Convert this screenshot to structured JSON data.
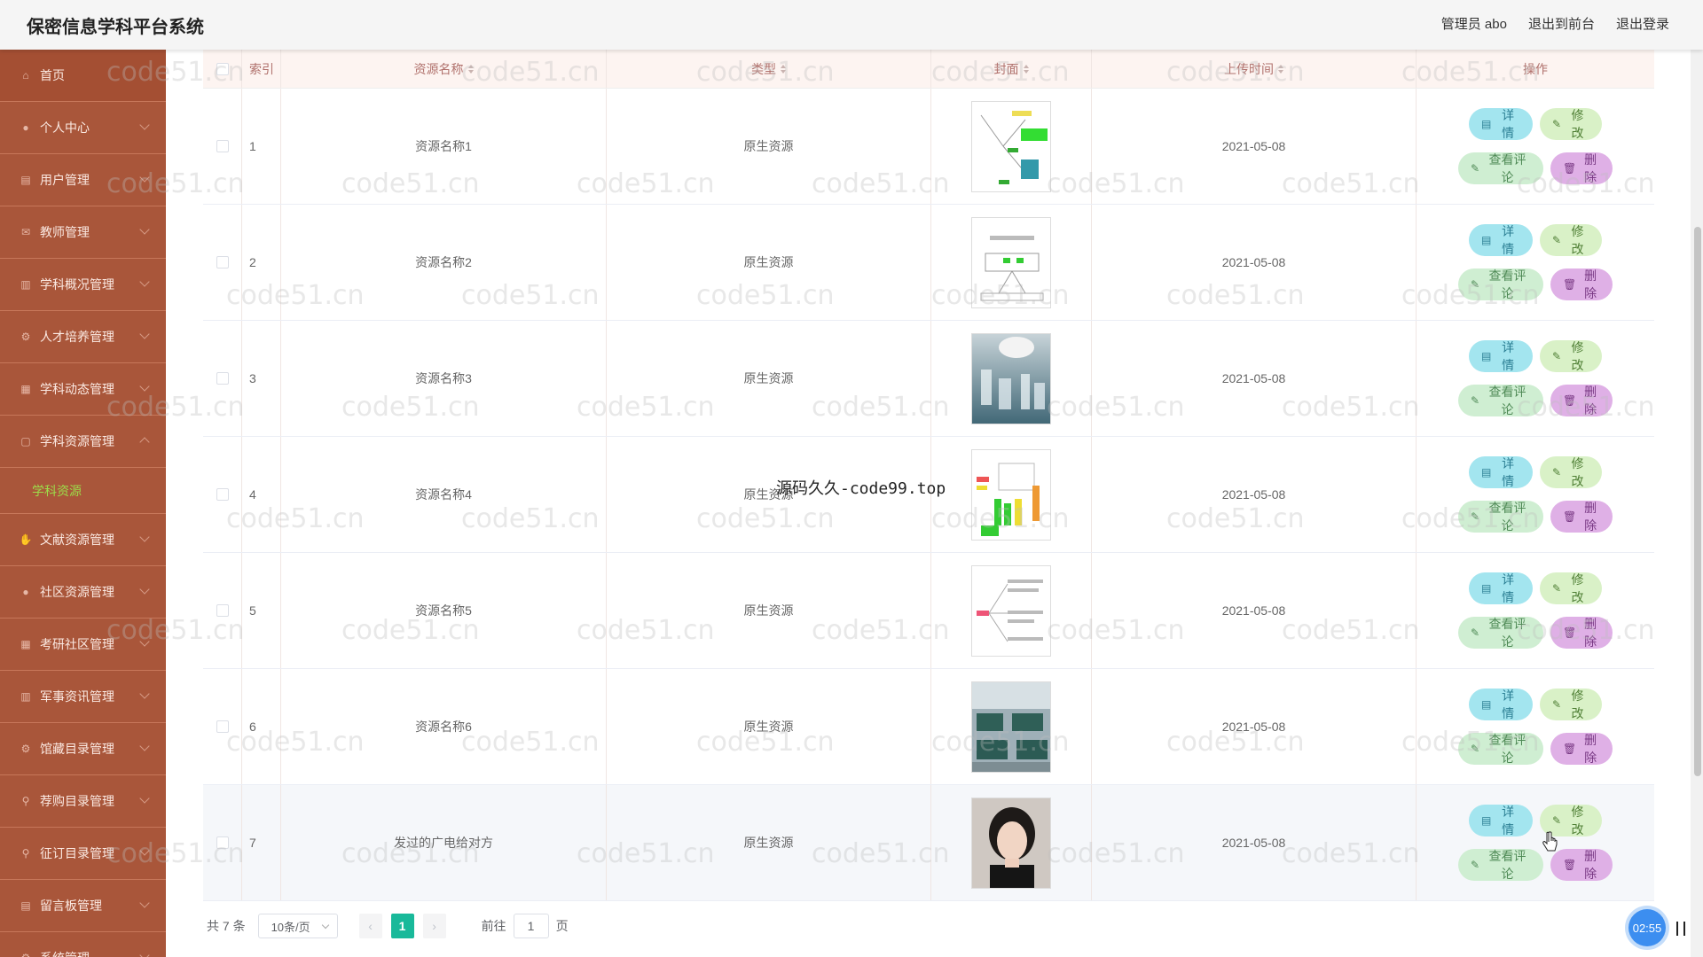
{
  "header": {
    "app_title": "保密信息学科平台系统",
    "admin_label": "管理员 abo",
    "back_front": "退出到前台",
    "logout": "退出登录"
  },
  "sidebar": {
    "items": [
      {
        "label": "首页",
        "icon": "home-icon"
      },
      {
        "label": "个人中心",
        "icon": "user-icon"
      },
      {
        "label": "用户管理",
        "icon": "document-icon"
      },
      {
        "label": "教师管理",
        "icon": "mail-icon"
      },
      {
        "label": "学科概况管理",
        "icon": "chart-icon"
      },
      {
        "label": "人才培养管理",
        "icon": "gear-icon"
      },
      {
        "label": "学科动态管理",
        "icon": "grid-icon"
      },
      {
        "label": "学科资源管理",
        "icon": "folder-icon",
        "open": true
      },
      {
        "label": "文献资源管理",
        "icon": "thumbs-icon"
      },
      {
        "label": "社区资源管理",
        "icon": "user-icon"
      },
      {
        "label": "考研社区管理",
        "icon": "grid-icon"
      },
      {
        "label": "军事资讯管理",
        "icon": "chart-icon"
      },
      {
        "label": "馆藏目录管理",
        "icon": "gear-icon"
      },
      {
        "label": "荐购目录管理",
        "icon": "pin-icon"
      },
      {
        "label": "征订目录管理",
        "icon": "pin-icon"
      },
      {
        "label": "留言板管理",
        "icon": "document-icon"
      },
      {
        "label": "系统管理",
        "icon": "gear-icon"
      }
    ],
    "sub_active": "学科资源"
  },
  "table": {
    "headers": {
      "index": "索引",
      "name": "资源名称",
      "type": "类型",
      "cover": "封面",
      "time": "上传时间",
      "ops": "操作"
    },
    "rows": [
      {
        "index": "1",
        "name": "资源名称1",
        "type": "原生资源",
        "time": "2021-05-08",
        "cover": "mindmap-green"
      },
      {
        "index": "2",
        "name": "资源名称2",
        "type": "原生资源",
        "time": "2021-05-08",
        "cover": "flowchart"
      },
      {
        "index": "3",
        "name": "资源名称3",
        "type": "原生资源",
        "time": "2021-05-08",
        "cover": "lab-photo"
      },
      {
        "index": "4",
        "name": "资源名称4",
        "type": "原生资源",
        "time": "2021-05-08",
        "cover": "mindmap-colorful"
      },
      {
        "index": "5",
        "name": "资源名称5",
        "type": "原生资源",
        "time": "2021-05-08",
        "cover": "mindmap-red"
      },
      {
        "index": "6",
        "name": "资源名称6",
        "type": "原生资源",
        "time": "2021-05-08",
        "cover": "classroom-photo"
      },
      {
        "index": "7",
        "name": "发过的广电给对方",
        "type": "原生资源",
        "time": "2021-05-08",
        "cover": "portrait-photo"
      }
    ],
    "buttons": {
      "detail": "详情",
      "edit": "修改",
      "comment": "查看评论",
      "delete": "删除"
    }
  },
  "pagination": {
    "total": "共 7 条",
    "page_size": "10条/页",
    "current": "1",
    "goto_prefix": "前往",
    "goto_value": "1",
    "goto_suffix": "页"
  },
  "watermark": {
    "text": "code51.cn",
    "center": "源码久久-code99.top"
  },
  "timer": "02:55",
  "colors": {
    "sidebar": "#a9563a",
    "active_sub": "#9cdc4a",
    "page_active": "#19b99a",
    "detail_btn": "#a3e5ef",
    "edit_btn": "#d9f1c7",
    "comment_btn": "#cfeed2",
    "delete_btn": "#dfb0e6"
  }
}
